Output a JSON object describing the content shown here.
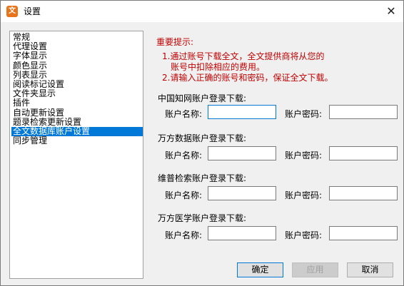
{
  "window": {
    "title": "设置",
    "app_icon_glyph": "文"
  },
  "nav": {
    "items": [
      {
        "label": "常规",
        "selected": false
      },
      {
        "label": "代理设置",
        "selected": false
      },
      {
        "label": "字体显示",
        "selected": false
      },
      {
        "label": "颜色显示",
        "selected": false
      },
      {
        "label": "列表显示",
        "selected": false
      },
      {
        "label": "阅读标记设置",
        "selected": false
      },
      {
        "label": "文件夹显示",
        "selected": false
      },
      {
        "label": "插件",
        "selected": false
      },
      {
        "label": "自动更新设置",
        "selected": false
      },
      {
        "label": "题录检索更新设置",
        "selected": false
      },
      {
        "label": "全文数据库账户设置",
        "selected": true
      },
      {
        "label": "同步管理",
        "selected": false
      }
    ]
  },
  "tips": {
    "title": "重要提示:",
    "line1": "1.通过账号下载全文，全文提供商将从您的",
    "line1b": "账号中扣除相应的费用。",
    "line2": "2.请输入正确的账号和密码，保证全文下载。"
  },
  "sections": [
    {
      "title": "中国知网账户登录下载:",
      "name_label": "账户名称:",
      "pwd_label": "账户密码:",
      "name_value": "",
      "pwd_value": ""
    },
    {
      "title": "万方数据账户登录下载:",
      "name_label": "账户名称:",
      "pwd_label": "账户密码:",
      "name_value": "",
      "pwd_value": ""
    },
    {
      "title": "维普检索账户登录下载:",
      "name_label": "账户名称:",
      "pwd_label": "账户密码:",
      "name_value": "",
      "pwd_value": ""
    },
    {
      "title": "万方医学账户登录下载:",
      "name_label": "账户名称:",
      "pwd_label": "账户密码:",
      "name_value": "",
      "pwd_value": ""
    }
  ],
  "buttons": {
    "ok": "确定",
    "apply": "应用",
    "cancel": "取消"
  },
  "icons": {
    "close": "close-icon",
    "app": "app-icon"
  },
  "colors": {
    "accent": "#0078d7",
    "warning": "#c00000"
  }
}
